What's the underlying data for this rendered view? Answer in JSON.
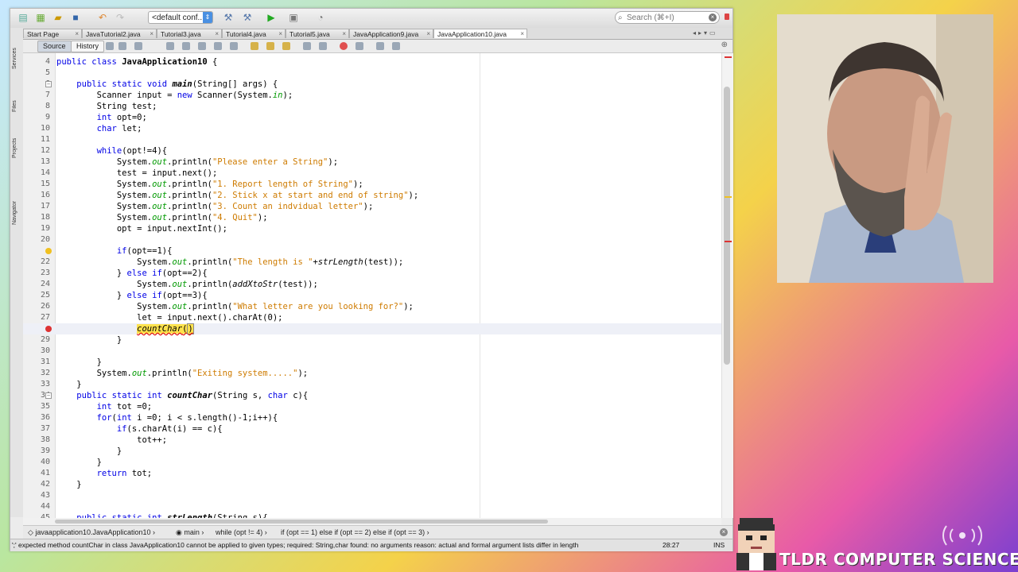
{
  "toolbar": {
    "config_label": "<default conf...",
    "search_placeholder": "Search (⌘+I)"
  },
  "tabs": [
    {
      "label": "Start Page"
    },
    {
      "label": "JavaTutorial2.java"
    },
    {
      "label": "Tutorial3.java"
    },
    {
      "label": "Tutorial4.java"
    },
    {
      "label": "Tutorial5.java"
    },
    {
      "label": "JavaApplication9.java"
    },
    {
      "label": "JavaApplication10.java",
      "active": true
    }
  ],
  "side_panels": [
    "Services",
    "Files",
    "Projects",
    "Navigator"
  ],
  "editor_bar": {
    "source": "Source",
    "history": "History"
  },
  "code_lines": [
    {
      "n": "4",
      "html": "public class <b>JavaApplication10</b> {"
    },
    {
      "n": "5",
      "html": ""
    },
    {
      "n": "6",
      "html": "    public static void <b><i>main</i></b>(String[] args) {"
    },
    {
      "n": "7",
      "html": "        Scanner input = new Scanner(System.<i>in</i>);"
    },
    {
      "n": "8",
      "html": "        String test;"
    },
    {
      "n": "9",
      "html": "        int opt=0;"
    },
    {
      "n": "10",
      "html": "        char let;"
    },
    {
      "n": "11",
      "html": ""
    },
    {
      "n": "12",
      "html": "        while(opt!=4){"
    },
    {
      "n": "13",
      "html": "            System.<i>out</i>.println(\"Please enter a String\");"
    },
    {
      "n": "14",
      "html": "            test = input.next();"
    },
    {
      "n": "15",
      "html": "            System.<i>out</i>.println(\"1. Report length of String\");"
    },
    {
      "n": "16",
      "html": "            System.<i>out</i>.println(\"2. Stick x at start and end of string\");"
    },
    {
      "n": "17",
      "html": "            System.<i>out</i>.println(\"3. Count an indvidual letter\");"
    },
    {
      "n": "18",
      "html": "            System.<i>out</i>.println(\"4. Quit\");"
    },
    {
      "n": "19",
      "html": "            opt = input.nextInt();"
    },
    {
      "n": "20",
      "html": ""
    },
    {
      "n": "",
      "html": "            if(opt==1){"
    },
    {
      "n": "22",
      "html": "                System.<i>out</i>.println(\"The length is \"+<i>strLength</i>(test));"
    },
    {
      "n": "23",
      "html": "            } else if(opt==2){"
    },
    {
      "n": "24",
      "html": "                System.<i>out</i>.println(<i>addXtoStr</i>(test));"
    },
    {
      "n": "25",
      "html": "            } else if(opt==3){"
    },
    {
      "n": "26",
      "html": "                System.<i>out</i>.println(\"What letter are you looking for?\");"
    },
    {
      "n": "27",
      "html": "                let = input.next().charAt(0);"
    },
    {
      "n": "",
      "html": "                <i>countChar</i>()"
    },
    {
      "n": "29",
      "html": "            }"
    },
    {
      "n": "30",
      "html": ""
    },
    {
      "n": "31",
      "html": "        }"
    },
    {
      "n": "32",
      "html": "        System.<i>out</i>.println(\"Exiting system.....\");"
    },
    {
      "n": "33",
      "html": "    }"
    },
    {
      "n": "34",
      "html": "    public static int <b><i>countChar</i></b>(String s, char c){"
    },
    {
      "n": "35",
      "html": "        int tot =0;"
    },
    {
      "n": "36",
      "html": "        for(int i =0; i < s.length()-1;i++){"
    },
    {
      "n": "37",
      "html": "            if(s.charAt(i) == c){"
    },
    {
      "n": "38",
      "html": "                tot++;"
    },
    {
      "n": "39",
      "html": "            }"
    },
    {
      "n": "40",
      "html": "        }"
    },
    {
      "n": "41",
      "html": "        return tot;"
    },
    {
      "n": "42",
      "html": "    }"
    },
    {
      "n": "43",
      "html": ""
    },
    {
      "n": "44",
      "html": ""
    },
    {
      "n": "45",
      "html": "    public static int <b><i>strLength</i></b>(String s){"
    }
  ],
  "breadcrumbs": [
    "javaapplication10.JavaApplication10",
    "main",
    "while (opt != 4)",
    "if (opt == 1) else if (opt == 2) else if (opt == 3)"
  ],
  "status": {
    "message": "';' expected  method countChar in class JavaApplication10 cannot be applied to given types;   required: String,char   found: no arguments   reason: actual and formal argument lists differ in length",
    "position": "28:27",
    "mode": "INS"
  },
  "overlay": {
    "brand": "TLDR COMPUTER SCIENCE"
  },
  "colors": {
    "keyword": "#0000e6",
    "string": "#ce7b00",
    "field": "#009900",
    "error_underline": "#e00000",
    "current_line": "#eef0f7"
  }
}
